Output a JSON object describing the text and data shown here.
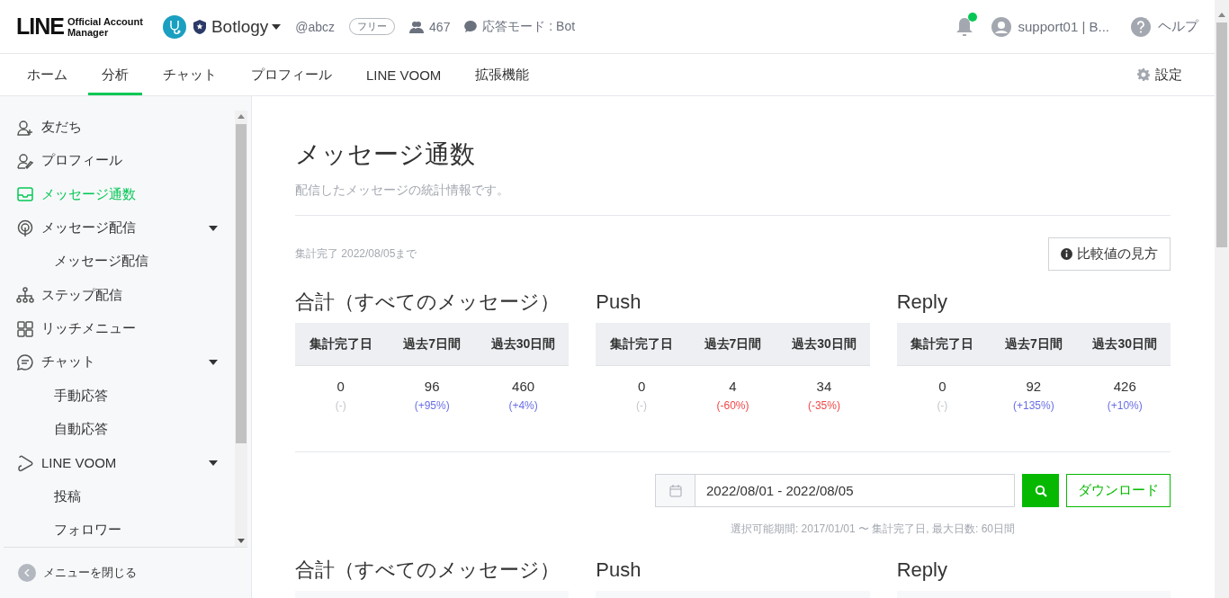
{
  "header": {
    "logo": {
      "wordmark": "LINE",
      "subtitle_1": "Official Account",
      "subtitle_2": "Manager"
    },
    "account": {
      "name": "Botlogy",
      "id": "@abcz",
      "plan": "フリー",
      "friends": "467",
      "mode": "応答モード : Bot"
    },
    "notifications": {
      "unread": true
    },
    "user": "support01 | B...",
    "help": "ヘルプ"
  },
  "nav": {
    "tabs": [
      {
        "label": "ホーム",
        "selected": false
      },
      {
        "label": "分析",
        "selected": true
      },
      {
        "label": "チャット",
        "selected": false
      },
      {
        "label": "プロフィール",
        "selected": false
      },
      {
        "label": "LINE VOOM",
        "selected": false
      },
      {
        "label": "拡張機能",
        "selected": false
      }
    ],
    "settings": "設定"
  },
  "sidebar": {
    "items": [
      {
        "kind": "friends",
        "label": "友だち",
        "selected": false
      },
      {
        "kind": "profile",
        "label": "プロフィール",
        "selected": false
      },
      {
        "kind": "inbox",
        "label": "メッセージ通数",
        "selected": true
      },
      {
        "kind": "broadcast",
        "label": "メッセージ配信",
        "selected": false,
        "expanded": true,
        "children": [
          {
            "label": "メッセージ配信",
            "selected": false
          }
        ]
      },
      {
        "kind": "step",
        "label": "ステップ配信",
        "selected": false
      },
      {
        "kind": "grid",
        "label": "リッチメニュー",
        "selected": false
      },
      {
        "kind": "chat",
        "label": "チャット",
        "selected": false,
        "expanded": true,
        "children": [
          {
            "label": "手動応答",
            "selected": false
          },
          {
            "label": "自動応答",
            "selected": false
          }
        ]
      },
      {
        "kind": "voom",
        "label": "LINE VOOM",
        "selected": false,
        "expanded": true,
        "children": [
          {
            "label": "投稿",
            "selected": false
          },
          {
            "label": "フォロワー",
            "selected": false
          }
        ]
      }
    ],
    "close": "メニューを閉じる"
  },
  "page": {
    "title": "メッセージ通数",
    "subtitle": "配信したメッセージの統計情報です。",
    "status": "集計完了 2022/08/05まで",
    "compare_button": "比較値の見方",
    "summaries": [
      {
        "title": "合計（すべてのメッセージ）",
        "columns": [
          "集計完了日",
          "過去7日間",
          "過去30日間"
        ],
        "values": [
          {
            "value": "0",
            "change": "(-)",
            "color": "#c3c7cd"
          },
          {
            "value": "96",
            "change": "(+95%)",
            "color": "#6a6fe6"
          },
          {
            "value": "460",
            "change": "(+4%)",
            "color": "#6a6fe6"
          }
        ]
      },
      {
        "title": "Push",
        "columns": [
          "集計完了日",
          "過去7日間",
          "過去30日間"
        ],
        "values": [
          {
            "value": "0",
            "change": "(-)",
            "color": "#c3c7cd"
          },
          {
            "value": "4",
            "change": "(-60%)",
            "color": "#f04848"
          },
          {
            "value": "34",
            "change": "(-35%)",
            "color": "#f04848"
          }
        ]
      },
      {
        "title": "Reply",
        "columns": [
          "集計完了日",
          "過去7日間",
          "過去30日間"
        ],
        "values": [
          {
            "value": "0",
            "change": "(-)",
            "color": "#c3c7cd"
          },
          {
            "value": "92",
            "change": "(+135%)",
            "color": "#6a6fe6"
          },
          {
            "value": "426",
            "change": "(+10%)",
            "color": "#6a6fe6"
          }
        ]
      }
    ],
    "date_range": "2022/08/01 - 2022/08/05",
    "download": "ダウンロード",
    "range_note": "選択可能期間: 2017/01/01 〜 集計完了日, 最大日数: 60日間",
    "details": [
      {
        "title": "合計（すべてのメッセージ）"
      },
      {
        "title": "Push"
      },
      {
        "title": "Reply"
      }
    ]
  }
}
